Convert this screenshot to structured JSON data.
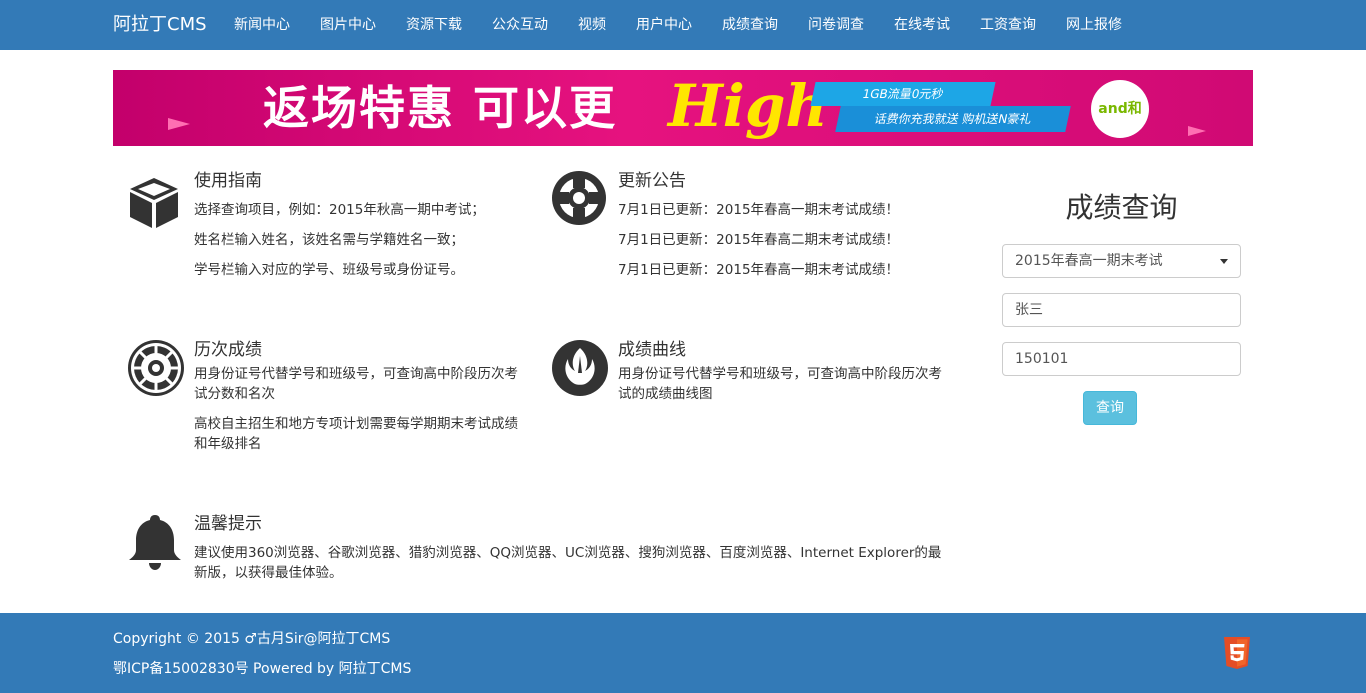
{
  "navbar": {
    "brand": "阿拉丁CMS",
    "items": [
      "新闻中心",
      "图片中心",
      "资源下载",
      "公众互动",
      "视频",
      "用户中心",
      "成绩查询",
      "问卷调查",
      "在线考试",
      "工资查询",
      "网上报修"
    ]
  },
  "banner": {
    "headline": "返场特惠 可以更",
    "highlight": "High",
    "promo1": "1GB流量0元秒",
    "promo2": "话费你充我就送  购机送N豪礼",
    "logo_text": "and和"
  },
  "features": {
    "guide": {
      "title": "使用指南",
      "icon": "cube-icon",
      "lines": [
        "选择查询项目，例如：2015年秋高一期中考试；",
        "姓名栏输入姓名，该姓名需与学籍姓名一致；",
        "学号栏输入对应的学号、班级号或身份证号。"
      ]
    },
    "notice": {
      "title": "更新公告",
      "icon": "life-ring-icon",
      "lines": [
        "7月1日已更新：2015年春高一期末考试成绩！",
        "7月1日已更新：2015年春高二期末考试成绩！",
        "7月1日已更新：2015年春高一期末考试成绩！"
      ]
    },
    "history": {
      "title": "历次成绩",
      "icon": "empire-icon",
      "lines": [
        "用身份证号代替学号和班级号，可查询高中阶段历次考试分数和名次",
        "高校自主招生和地方专项计划需要每学期期末考试成绩和年级排名"
      ]
    },
    "curve": {
      "title": "成绩曲线",
      "icon": "rebel-icon",
      "lines": [
        "用身份证号代替学号和班级号，可查询高中阶段历次考试的成绩曲线图"
      ]
    },
    "tips": {
      "title": "温馨提示",
      "icon": "bell-icon",
      "lines": [
        "建议使用360浏览器、谷歌浏览器、猎豹浏览器、QQ浏览器、UC浏览器、搜狗浏览器、百度浏览器、Internet Explorer的最新版，以获得最佳体验。"
      ]
    }
  },
  "query": {
    "title": "成绩查询",
    "exam_selected": "2015年春高一期末考试",
    "name_value": "张三",
    "number_value": "150101",
    "submit_label": "查询"
  },
  "footer": {
    "copyright": "Copyright © 2015 ♂古月Sir@阿拉丁CMS",
    "icp": "鄂ICP备15002830号 Powered by 阿拉丁CMS"
  },
  "colors": {
    "primary": "#337ab7",
    "button_info": "#5bc0de",
    "banner_magenta": "#d70c78",
    "html5_orange": "#e44d26"
  }
}
